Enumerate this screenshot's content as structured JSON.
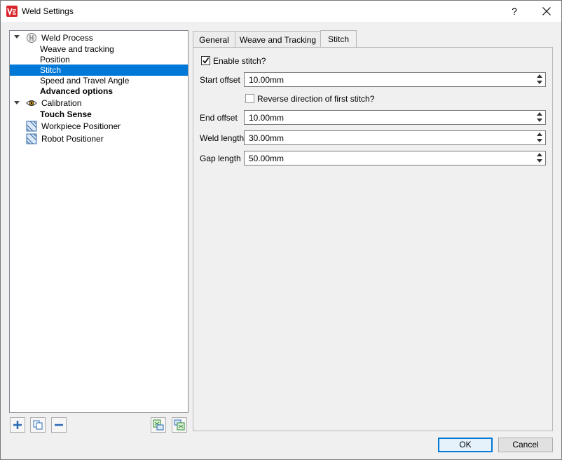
{
  "window": {
    "title": "Weld Settings",
    "help_label": "?"
  },
  "tree": {
    "items": [
      {
        "label": "Weld Process",
        "level": 0,
        "bold": false,
        "icon": "weld-process-icon",
        "expanded": true
      },
      {
        "label": "Weave and tracking",
        "level": 1
      },
      {
        "label": "Position",
        "level": 1
      },
      {
        "label": "Stitch",
        "level": 1,
        "selected": true
      },
      {
        "label": "Speed and Travel Angle",
        "level": 1
      },
      {
        "label": "Advanced options",
        "level": 1,
        "bold": true
      },
      {
        "label": "Calibration",
        "level": 0,
        "icon": "eye-icon",
        "expanded": true
      },
      {
        "label": "Touch Sense",
        "level": 1,
        "bold": true
      },
      {
        "label": "Workpiece Positioner",
        "level": 0,
        "icon": "positioner-icon"
      },
      {
        "label": "Robot Positioner",
        "level": 0,
        "icon": "positioner-icon"
      }
    ]
  },
  "tree_buttons": [
    "add-icon",
    "copy-icon",
    "remove-icon",
    "import-icon",
    "export-icon"
  ],
  "tabs": [
    {
      "label": "General",
      "active": false
    },
    {
      "label": "Weave and Tracking",
      "active": false
    },
    {
      "label": "Stitch",
      "active": true
    }
  ],
  "stitch": {
    "enable_label": "Enable stitch?",
    "enable_checked": true,
    "start_offset_label": "Start offset",
    "start_offset_value": "10.00mm",
    "reverse_label": "Reverse direction of first stitch?",
    "reverse_checked": false,
    "end_offset_label": "End offset",
    "end_offset_value": "10.00mm",
    "weld_length_label": "Weld length",
    "weld_length_value": "30.00mm",
    "gap_length_label": "Gap length",
    "gap_length_value": "50.00mm"
  },
  "buttons": {
    "ok": "OK",
    "cancel": "Cancel"
  },
  "colors": {
    "selection": "#0078d7",
    "app_icon": "#d9262c"
  }
}
